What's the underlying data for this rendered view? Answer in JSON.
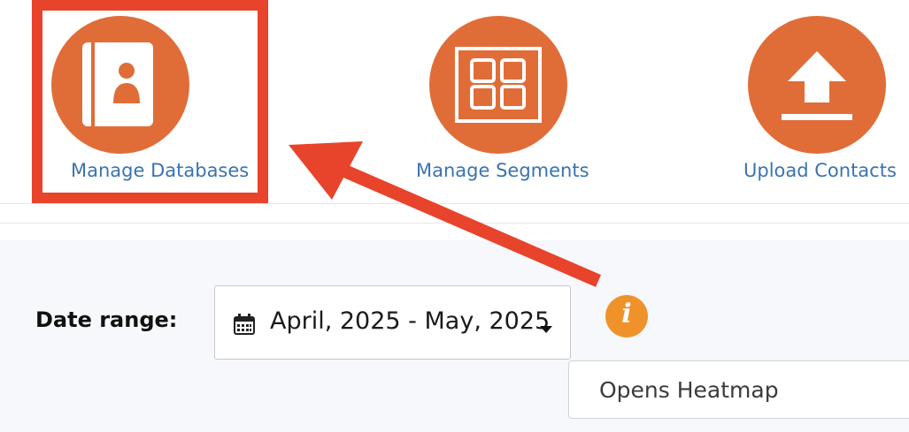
{
  "nav_tiles": [
    {
      "label": "Manage Databases",
      "icon": "address-book-icon"
    },
    {
      "label": "Manage Segments",
      "icon": "segments-grid-icon"
    },
    {
      "label": "Upload Contacts",
      "icon": "upload-arrow-icon"
    }
  ],
  "filters": {
    "date_range_label": "Date range:",
    "date_range_value": "April, 2025 - May, 2025"
  },
  "report_tabs": {
    "opens_heatmap": "Opens Heatmap"
  },
  "colors": {
    "tile_circle": "#e06d38",
    "tile_label": "#3a73b0",
    "annotation_red": "#e8432b",
    "info_orange": "#f0922a",
    "panel_bg": "#f7f8fc"
  }
}
